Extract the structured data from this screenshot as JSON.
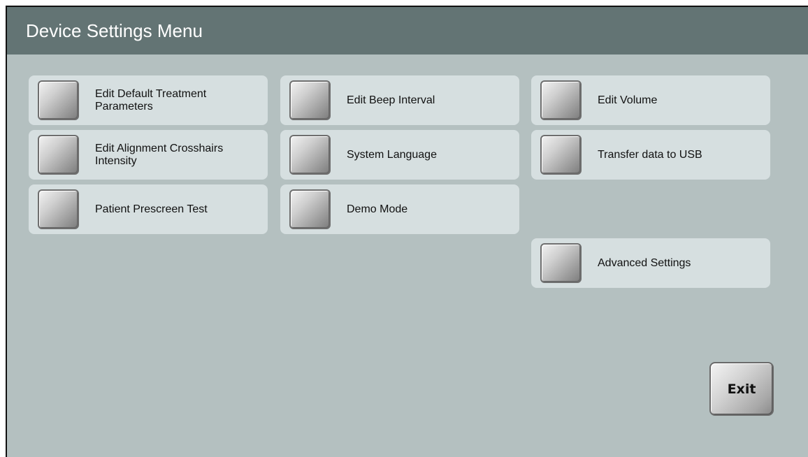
{
  "header": {
    "title": "Device Settings Menu"
  },
  "menu": {
    "col1": [
      {
        "label": "Edit Default Treatment Parameters"
      },
      {
        "label": "Edit Alignment Crosshairs Intensity"
      },
      {
        "label": "Patient Prescreen Test"
      }
    ],
    "col2": [
      {
        "label": "Edit Beep Interval"
      },
      {
        "label": "System Language"
      },
      {
        "label": "Demo Mode"
      }
    ],
    "col3": [
      {
        "label": "Edit Volume"
      },
      {
        "label": "Transfer data to USB"
      },
      {
        "label": "Advanced Settings"
      }
    ]
  },
  "footer": {
    "exit_label": "Exit"
  },
  "colors": {
    "background": "#b4c0c0",
    "title_bar": "#637474",
    "menu_item": "#d6dfe0"
  }
}
